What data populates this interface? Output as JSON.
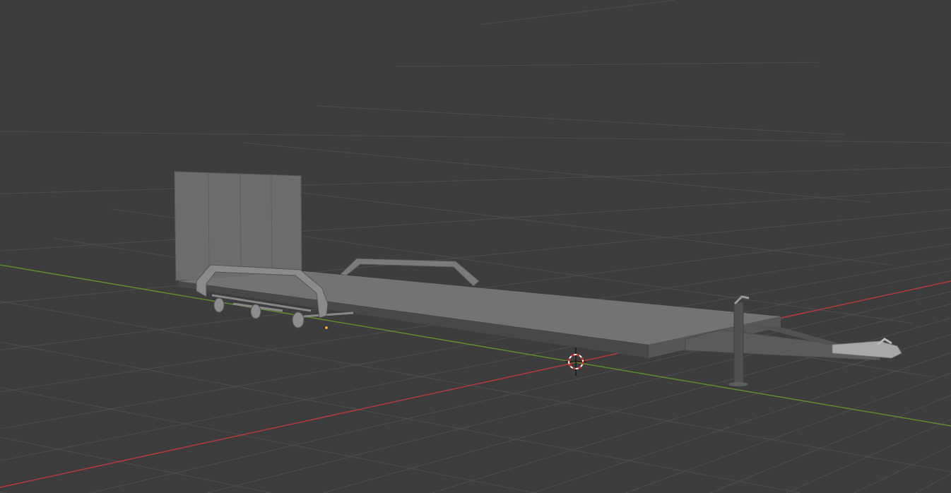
{
  "viewport": {
    "mode": "3D Viewport",
    "background_color": "#3d3d3d",
    "grid_color": "#4a4a4a",
    "x_axis_color": "#b5393d",
    "y_axis_color": "#5c8c2c",
    "object_color": "#6e6f70",
    "origin_color": "#f5a623"
  },
  "scene": {
    "object": "trailer-model",
    "parts": [
      "headboard",
      "deck",
      "fender-left",
      "fender-right",
      "axles",
      "wheels",
      "drawbar",
      "jack-stand",
      "coupler"
    ]
  }
}
